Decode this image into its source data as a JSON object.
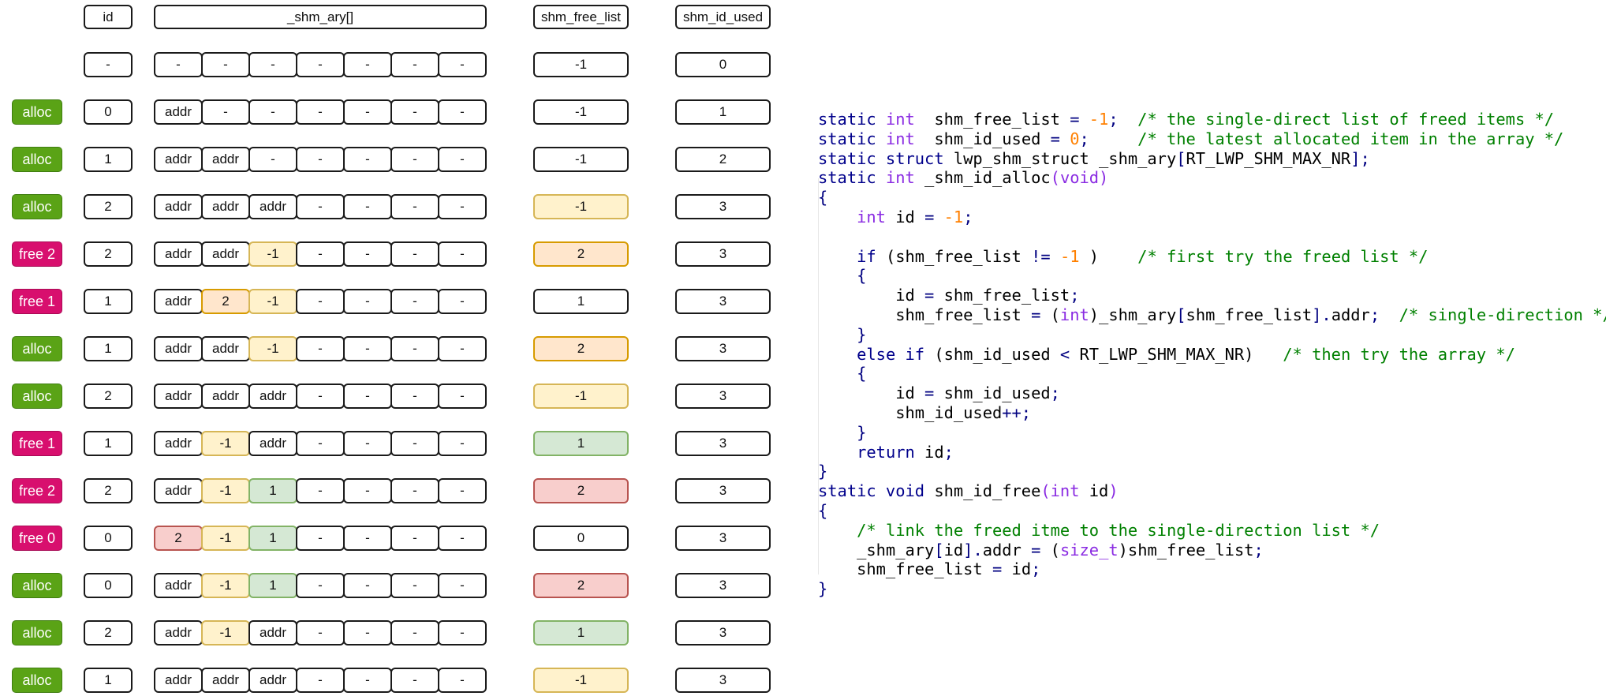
{
  "headers": {
    "id": "id",
    "array": "_shm_ary[]",
    "free_list": "shm_free_list",
    "id_used": "shm_id_used"
  },
  "rows": [
    {
      "op": "",
      "op_kind": "",
      "id": "-",
      "cells": [
        "-",
        "-",
        "-",
        "-",
        "-",
        "-",
        "-"
      ],
      "cell_colors": [
        "",
        "",
        "",
        "",
        "",
        "",
        ""
      ],
      "free_list": "-1",
      "free_list_color": "",
      "id_used": "0"
    },
    {
      "op": "alloc",
      "op_kind": "alloc",
      "id": "0",
      "cells": [
        "addr",
        "-",
        "-",
        "-",
        "-",
        "-",
        "-"
      ],
      "cell_colors": [
        "",
        "",
        "",
        "",
        "",
        "",
        ""
      ],
      "free_list": "-1",
      "free_list_color": "",
      "id_used": "1"
    },
    {
      "op": "alloc",
      "op_kind": "alloc",
      "id": "1",
      "cells": [
        "addr",
        "addr",
        "-",
        "-",
        "-",
        "-",
        "-"
      ],
      "cell_colors": [
        "",
        "",
        "",
        "",
        "",
        "",
        ""
      ],
      "free_list": "-1",
      "free_list_color": "",
      "id_used": "2"
    },
    {
      "op": "alloc",
      "op_kind": "alloc",
      "id": "2",
      "cells": [
        "addr",
        "addr",
        "addr",
        "-",
        "-",
        "-",
        "-"
      ],
      "cell_colors": [
        "",
        "",
        "",
        "",
        "",
        "",
        ""
      ],
      "free_list": "-1",
      "free_list_color": "yellow",
      "id_used": "3"
    },
    {
      "op": "free 2",
      "op_kind": "free",
      "id": "2",
      "cells": [
        "addr",
        "addr",
        "-1",
        "-",
        "-",
        "-",
        "-"
      ],
      "cell_colors": [
        "",
        "",
        "yellow",
        "",
        "",
        "",
        ""
      ],
      "free_list": "2",
      "free_list_color": "orange",
      "id_used": "3"
    },
    {
      "op": "free 1",
      "op_kind": "free",
      "id": "1",
      "cells": [
        "addr",
        "2",
        "-1",
        "-",
        "-",
        "-",
        "-"
      ],
      "cell_colors": [
        "",
        "orange",
        "yellow",
        "",
        "",
        "",
        ""
      ],
      "free_list": "1",
      "free_list_color": "",
      "id_used": "3"
    },
    {
      "op": "alloc",
      "op_kind": "alloc",
      "id": "1",
      "cells": [
        "addr",
        "addr",
        "-1",
        "-",
        "-",
        "-",
        "-"
      ],
      "cell_colors": [
        "",
        "",
        "yellow",
        "",
        "",
        "",
        ""
      ],
      "free_list": "2",
      "free_list_color": "orange",
      "id_used": "3"
    },
    {
      "op": "alloc",
      "op_kind": "alloc",
      "id": "2",
      "cells": [
        "addr",
        "addr",
        "addr",
        "-",
        "-",
        "-",
        "-"
      ],
      "cell_colors": [
        "",
        "",
        "",
        "",
        "",
        "",
        ""
      ],
      "free_list": "-1",
      "free_list_color": "yellow",
      "id_used": "3"
    },
    {
      "op": "free 1",
      "op_kind": "free",
      "id": "1",
      "cells": [
        "addr",
        "-1",
        "addr",
        "-",
        "-",
        "-",
        "-"
      ],
      "cell_colors": [
        "",
        "yellow",
        "",
        "",
        "",
        "",
        ""
      ],
      "free_list": "1",
      "free_list_color": "green",
      "id_used": "3"
    },
    {
      "op": "free 2",
      "op_kind": "free",
      "id": "2",
      "cells": [
        "addr",
        "-1",
        "1",
        "-",
        "-",
        "-",
        "-"
      ],
      "cell_colors": [
        "",
        "yellow",
        "green",
        "",
        "",
        "",
        ""
      ],
      "free_list": "2",
      "free_list_color": "red",
      "id_used": "3"
    },
    {
      "op": "free 0",
      "op_kind": "free",
      "id": "0",
      "cells": [
        "2",
        "-1",
        "1",
        "-",
        "-",
        "-",
        "-"
      ],
      "cell_colors": [
        "red",
        "yellow",
        "green",
        "",
        "",
        "",
        ""
      ],
      "free_list": "0",
      "free_list_color": "",
      "id_used": "3"
    },
    {
      "op": "alloc",
      "op_kind": "alloc",
      "id": "0",
      "cells": [
        "addr",
        "-1",
        "1",
        "-",
        "-",
        "-",
        "-"
      ],
      "cell_colors": [
        "",
        "yellow",
        "green",
        "",
        "",
        "",
        ""
      ],
      "free_list": "2",
      "free_list_color": "red",
      "id_used": "3"
    },
    {
      "op": "alloc",
      "op_kind": "alloc",
      "id": "2",
      "cells": [
        "addr",
        "-1",
        "addr",
        "-",
        "-",
        "-",
        "-"
      ],
      "cell_colors": [
        "",
        "yellow",
        "",
        "",
        "",
        "",
        ""
      ],
      "free_list": "1",
      "free_list_color": "green",
      "id_used": "3"
    },
    {
      "op": "alloc",
      "op_kind": "alloc",
      "id": "1",
      "cells": [
        "addr",
        "addr",
        "addr",
        "-",
        "-",
        "-",
        "-"
      ],
      "cell_colors": [
        "",
        "",
        "",
        "",
        "",
        "",
        ""
      ],
      "free_list": "-1",
      "free_list_color": "yellow",
      "id_used": "3"
    }
  ],
  "colors": {
    "alloc": "#5aa316",
    "free": "#d80f6e",
    "yellow": "#fff2cc",
    "orange": "#ffe6cc",
    "green": "#d5e8d4",
    "red": "#f8cecc",
    "keyword": "#00008b",
    "type": "#8a2be2",
    "number": "#ff8000",
    "comment": "#008000"
  },
  "code": {
    "lines": [
      [
        [
          "kw",
          "static "
        ],
        [
          "ty",
          "int"
        ],
        [
          "",
          "  shm_free_list "
        ],
        [
          "op",
          "="
        ],
        [
          "",
          " "
        ],
        [
          "num",
          "-1"
        ],
        [
          "op",
          ";"
        ],
        [
          "",
          "  "
        ],
        [
          "cm",
          "/* the single-direct list of freed items */"
        ]
      ],
      [
        [
          "kw",
          "static "
        ],
        [
          "ty",
          "int"
        ],
        [
          "",
          "  shm_id_used "
        ],
        [
          "op",
          "="
        ],
        [
          "",
          " "
        ],
        [
          "num",
          "0"
        ],
        [
          "op",
          ";"
        ],
        [
          "",
          "     "
        ],
        [
          "cm",
          "/* the latest allocated item in the array */"
        ]
      ],
      [
        [
          "kw",
          "static struct"
        ],
        [
          "",
          " lwp_shm_struct _shm_ary"
        ],
        [
          "op",
          "["
        ],
        [
          "",
          "RT_LWP_SHM_MAX_NR"
        ],
        [
          "op",
          "];"
        ]
      ],
      [
        [
          "kw",
          "static "
        ],
        [
          "ty",
          "int"
        ],
        [
          "",
          " _shm_id_alloc"
        ],
        [
          "ty",
          "("
        ],
        [
          "ty",
          "void"
        ],
        [
          "ty",
          ")"
        ]
      ],
      [
        [
          "op",
          "{"
        ]
      ],
      [
        [
          "",
          "    "
        ],
        [
          "ty",
          "int"
        ],
        [
          "",
          " id "
        ],
        [
          "op",
          "="
        ],
        [
          "",
          " "
        ],
        [
          "num",
          "-1"
        ],
        [
          "op",
          ";"
        ]
      ],
      [
        [
          "",
          ""
        ]
      ],
      [
        [
          "",
          "    "
        ],
        [
          "kw",
          "if"
        ],
        [
          "",
          " (shm_free_list "
        ],
        [
          "op",
          "!="
        ],
        [
          "",
          " "
        ],
        [
          "num",
          "-1"
        ],
        [
          "",
          " )    "
        ],
        [
          "cm",
          "/* first try the freed list */"
        ]
      ],
      [
        [
          "",
          "    "
        ],
        [
          "op",
          "{"
        ]
      ],
      [
        [
          "",
          "        id "
        ],
        [
          "op",
          "="
        ],
        [
          "",
          " shm_free_list"
        ],
        [
          "op",
          ";"
        ]
      ],
      [
        [
          "",
          "        shm_free_list "
        ],
        [
          "op",
          "="
        ],
        [
          "",
          " ("
        ],
        [
          "ty",
          "int"
        ],
        [
          "",
          ")_shm_ary"
        ],
        [
          "op",
          "["
        ],
        [
          "",
          "shm_free_list"
        ],
        [
          "op",
          "]."
        ],
        [
          "",
          "addr"
        ],
        [
          "op",
          ";"
        ],
        [
          "",
          "  "
        ],
        [
          "cm",
          "/* single-direction */"
        ]
      ],
      [
        [
          "",
          "    "
        ],
        [
          "op",
          "}"
        ]
      ],
      [
        [
          "",
          "    "
        ],
        [
          "kw",
          "else if"
        ],
        [
          "",
          " (shm_id_used "
        ],
        [
          "op",
          "<"
        ],
        [
          "",
          " RT_LWP_SHM_MAX_NR)   "
        ],
        [
          "cm",
          "/* then try the array */"
        ]
      ],
      [
        [
          "",
          "    "
        ],
        [
          "op",
          "{"
        ]
      ],
      [
        [
          "",
          "        id "
        ],
        [
          "op",
          "="
        ],
        [
          "",
          " shm_id_used"
        ],
        [
          "op",
          ";"
        ]
      ],
      [
        [
          "",
          "        shm_id_used"
        ],
        [
          "op",
          "++;"
        ]
      ],
      [
        [
          "",
          "    "
        ],
        [
          "op",
          "}"
        ]
      ],
      [
        [
          "",
          "    "
        ],
        [
          "kw",
          "return"
        ],
        [
          "",
          " id"
        ],
        [
          "op",
          ";"
        ]
      ],
      [
        [
          "op",
          "}"
        ]
      ],
      [
        [
          "kw",
          "static void"
        ],
        [
          "",
          " shm_id_free"
        ],
        [
          "ty",
          "("
        ],
        [
          "ty",
          "int"
        ],
        [
          "",
          " id"
        ],
        [
          "ty",
          ")"
        ]
      ],
      [
        [
          "op",
          "{"
        ]
      ],
      [
        [
          "",
          "    "
        ],
        [
          "cm",
          "/* link the freed itme to the single-direction list */"
        ]
      ],
      [
        [
          "",
          "    _shm_ary"
        ],
        [
          "op",
          "["
        ],
        [
          "",
          "id"
        ],
        [
          "op",
          "]."
        ],
        [
          "",
          "addr "
        ],
        [
          "op",
          "="
        ],
        [
          "",
          " ("
        ],
        [
          "ty",
          "size_t"
        ],
        [
          "",
          ")shm_free_list"
        ],
        [
          "op",
          ";"
        ]
      ],
      [
        [
          "",
          "    shm_free_list "
        ],
        [
          "op",
          "="
        ],
        [
          "",
          " id"
        ],
        [
          "op",
          ";"
        ]
      ],
      [
        [
          "op",
          "}"
        ]
      ]
    ]
  }
}
